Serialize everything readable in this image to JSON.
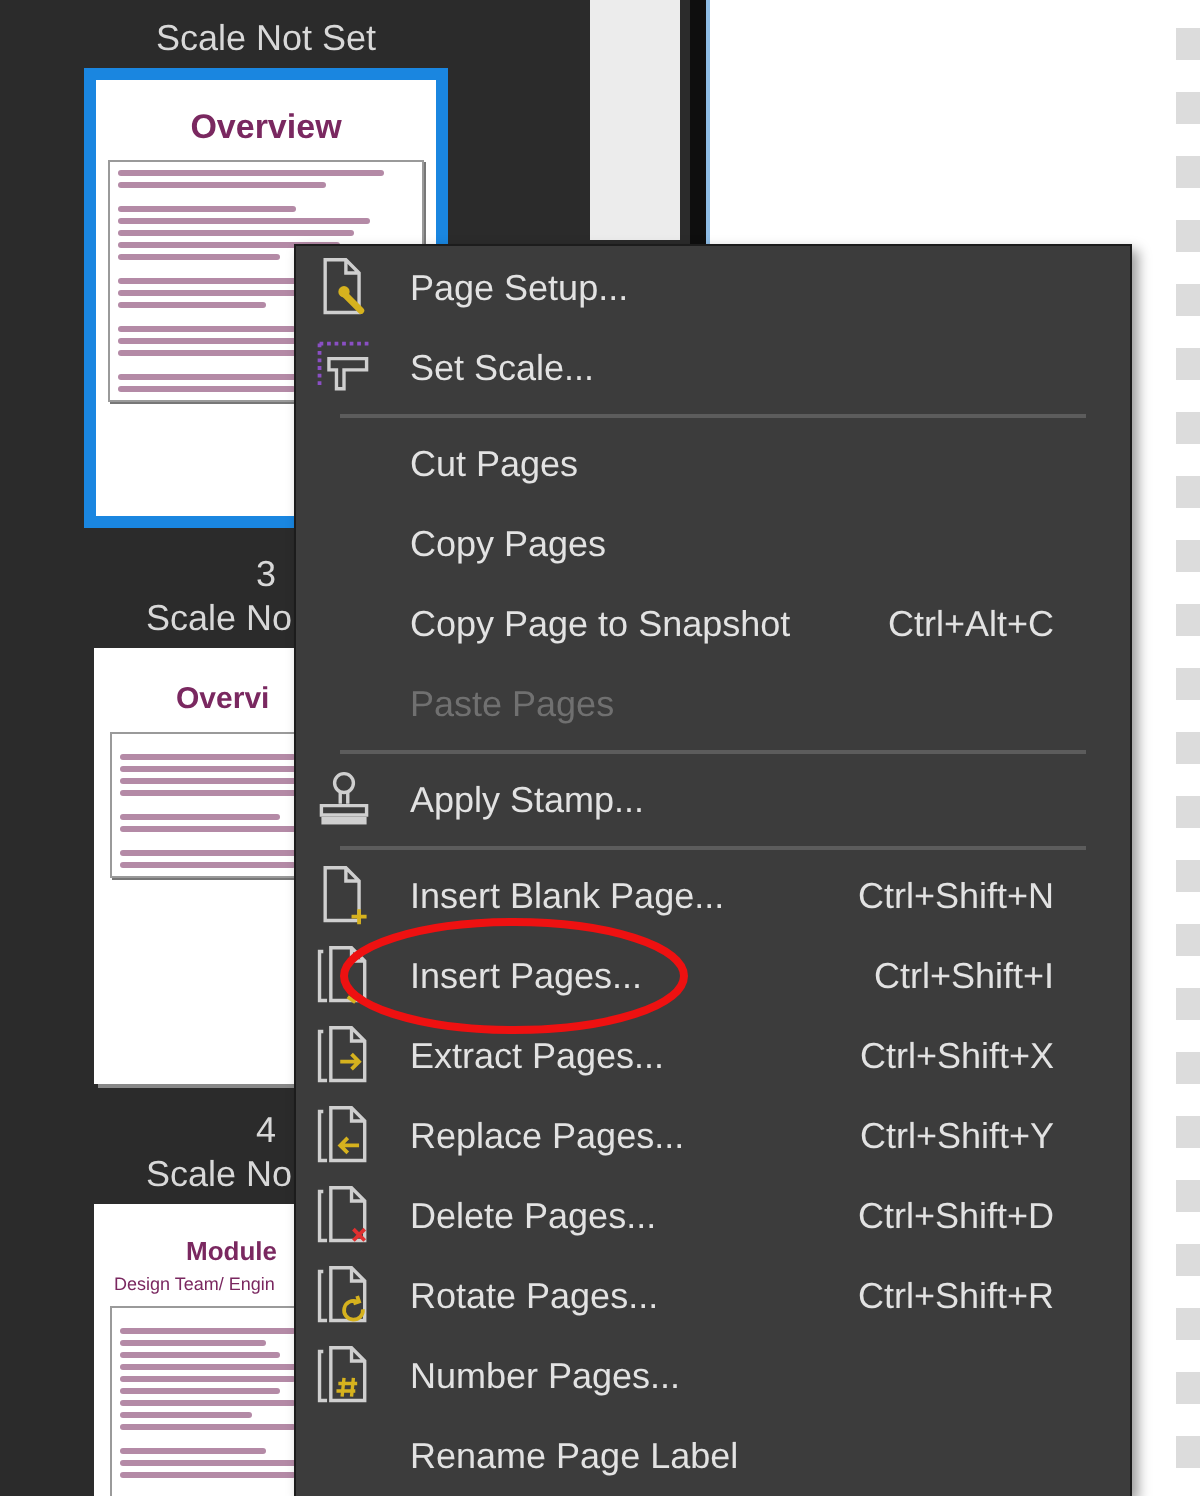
{
  "thumbnails_panel": {
    "pages": [
      {
        "scale_label": "Scale Not Set",
        "selected": true,
        "heading": "Overview"
      },
      {
        "number": "3",
        "scale_label": "Scale No",
        "selected": false,
        "heading": "Overvi"
      },
      {
        "number": "4",
        "scale_label": "Scale No",
        "selected": false,
        "heading": "Module",
        "subheading": "Design Team/ Engin"
      }
    ]
  },
  "context_menu": {
    "items": [
      {
        "kind": "item",
        "label": "Page Setup...",
        "disabled": false,
        "circled": false
      },
      {
        "kind": "item",
        "label": "Set Scale...",
        "disabled": false,
        "circled": false
      },
      {
        "kind": "separator"
      },
      {
        "kind": "item",
        "label": "Cut Pages",
        "disabled": false,
        "circled": false
      },
      {
        "kind": "item",
        "label": "Copy Pages",
        "disabled": false,
        "circled": false
      },
      {
        "kind": "item",
        "label": "Copy Page to Snapshot",
        "shortcut": "Ctrl+Alt+C",
        "disabled": false,
        "circled": false
      },
      {
        "kind": "item",
        "label": "Paste Pages",
        "disabled": true,
        "circled": false
      },
      {
        "kind": "separator"
      },
      {
        "kind": "item",
        "label": "Apply Stamp...",
        "disabled": false,
        "circled": false
      },
      {
        "kind": "separator"
      },
      {
        "kind": "item",
        "label": "Insert Blank Page...",
        "shortcut": "Ctrl+Shift+N",
        "disabled": false,
        "circled": false
      },
      {
        "kind": "item",
        "label": "Insert Pages...",
        "shortcut": "Ctrl+Shift+I",
        "disabled": false,
        "circled": true
      },
      {
        "kind": "item",
        "label": "Extract Pages...",
        "shortcut": "Ctrl+Shift+X",
        "disabled": false,
        "circled": false
      },
      {
        "kind": "item",
        "label": "Replace Pages...",
        "shortcut": "Ctrl+Shift+Y",
        "disabled": false,
        "circled": false
      },
      {
        "kind": "item",
        "label": "Delete Pages...",
        "shortcut": "Ctrl+Shift+D",
        "disabled": false,
        "circled": false
      },
      {
        "kind": "item",
        "label": "Rotate Pages...",
        "shortcut": "Ctrl+Shift+R",
        "disabled": false,
        "circled": false
      },
      {
        "kind": "item",
        "label": "Number Pages...",
        "disabled": false,
        "circled": false
      },
      {
        "kind": "item",
        "label": "Rename Page Label",
        "disabled": false,
        "circled": false
      }
    ]
  }
}
